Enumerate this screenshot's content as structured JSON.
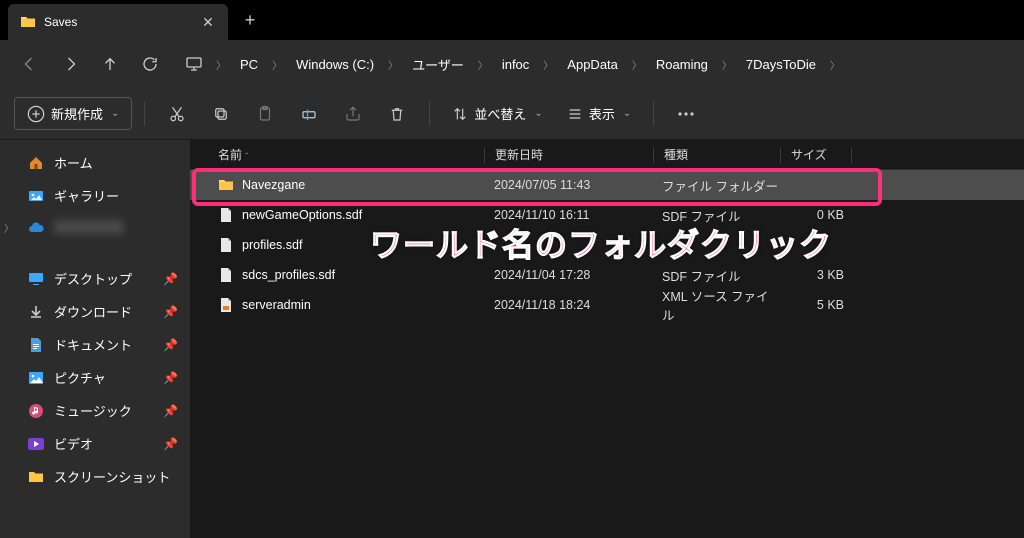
{
  "tab": {
    "title": "Saves"
  },
  "breadcrumb": [
    "PC",
    "Windows (C:)",
    "ユーザー",
    "infoc",
    "AppData",
    "Roaming",
    "7DaysToDie"
  ],
  "toolbar": {
    "new_label": "新規作成",
    "sort_label": "並べ替え",
    "view_label": "表示"
  },
  "sidebar": {
    "home": "ホーム",
    "gallery": "ギャラリー",
    "desktop": "デスクトップ",
    "downloads": "ダウンロード",
    "documents": "ドキュメント",
    "pictures": "ピクチャ",
    "music": "ミュージック",
    "videos": "ビデオ",
    "screenshots": "スクリーンショット"
  },
  "columns": {
    "name": "名前",
    "date": "更新日時",
    "type": "種類",
    "size": "サイズ"
  },
  "rows": [
    {
      "name": "Navezgane",
      "date": "2024/07/05 11:43",
      "type": "ファイル フォルダー",
      "size": "",
      "icon": "folder",
      "selected": true
    },
    {
      "name": "newGameOptions.sdf",
      "date": "2024/11/10 16:11",
      "type": "SDF ファイル",
      "size": "0 KB",
      "icon": "file",
      "selected": false
    },
    {
      "name": "profiles.sdf",
      "date": "",
      "type": "",
      "size": "",
      "icon": "file",
      "selected": false
    },
    {
      "name": "sdcs_profiles.sdf",
      "date": "2024/11/04 17:28",
      "type": "SDF ファイル",
      "size": "3 KB",
      "icon": "file",
      "selected": false
    },
    {
      "name": "serveradmin",
      "date": "2024/11/18 18:24",
      "type": "XML ソース ファイル",
      "size": "5 KB",
      "icon": "xml",
      "selected": false
    }
  ],
  "annotation": "ワールド名のフォルダクリック"
}
